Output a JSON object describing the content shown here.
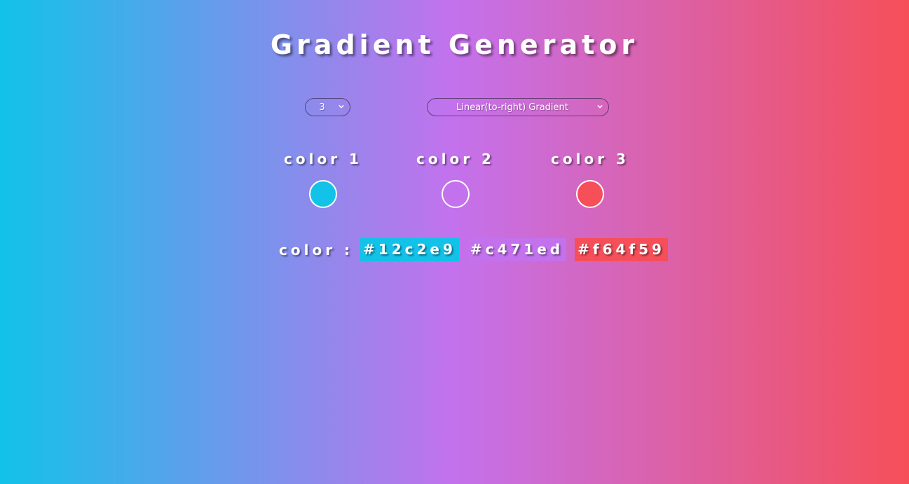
{
  "title": "Gradient Generator",
  "controls": {
    "count_selected": "3",
    "type_selected": "Linear(to-right) Gradient"
  },
  "colors": [
    {
      "label": "color 1",
      "hex": "#12c2e9"
    },
    {
      "label": "color 2",
      "hex": "#c471ed"
    },
    {
      "label": "color 3",
      "hex": "#f64f59"
    }
  ],
  "readout": {
    "prefix": "color :",
    "values": [
      "#12c2e9",
      "#c471ed",
      "#f64f59"
    ]
  },
  "icons": {
    "dropdown": "chevron-down-icon"
  },
  "palette": {
    "text": "#ffffff",
    "gradient_start": "#12c2e9",
    "gradient_mid": "#c471ed",
    "gradient_end": "#f64f59"
  }
}
